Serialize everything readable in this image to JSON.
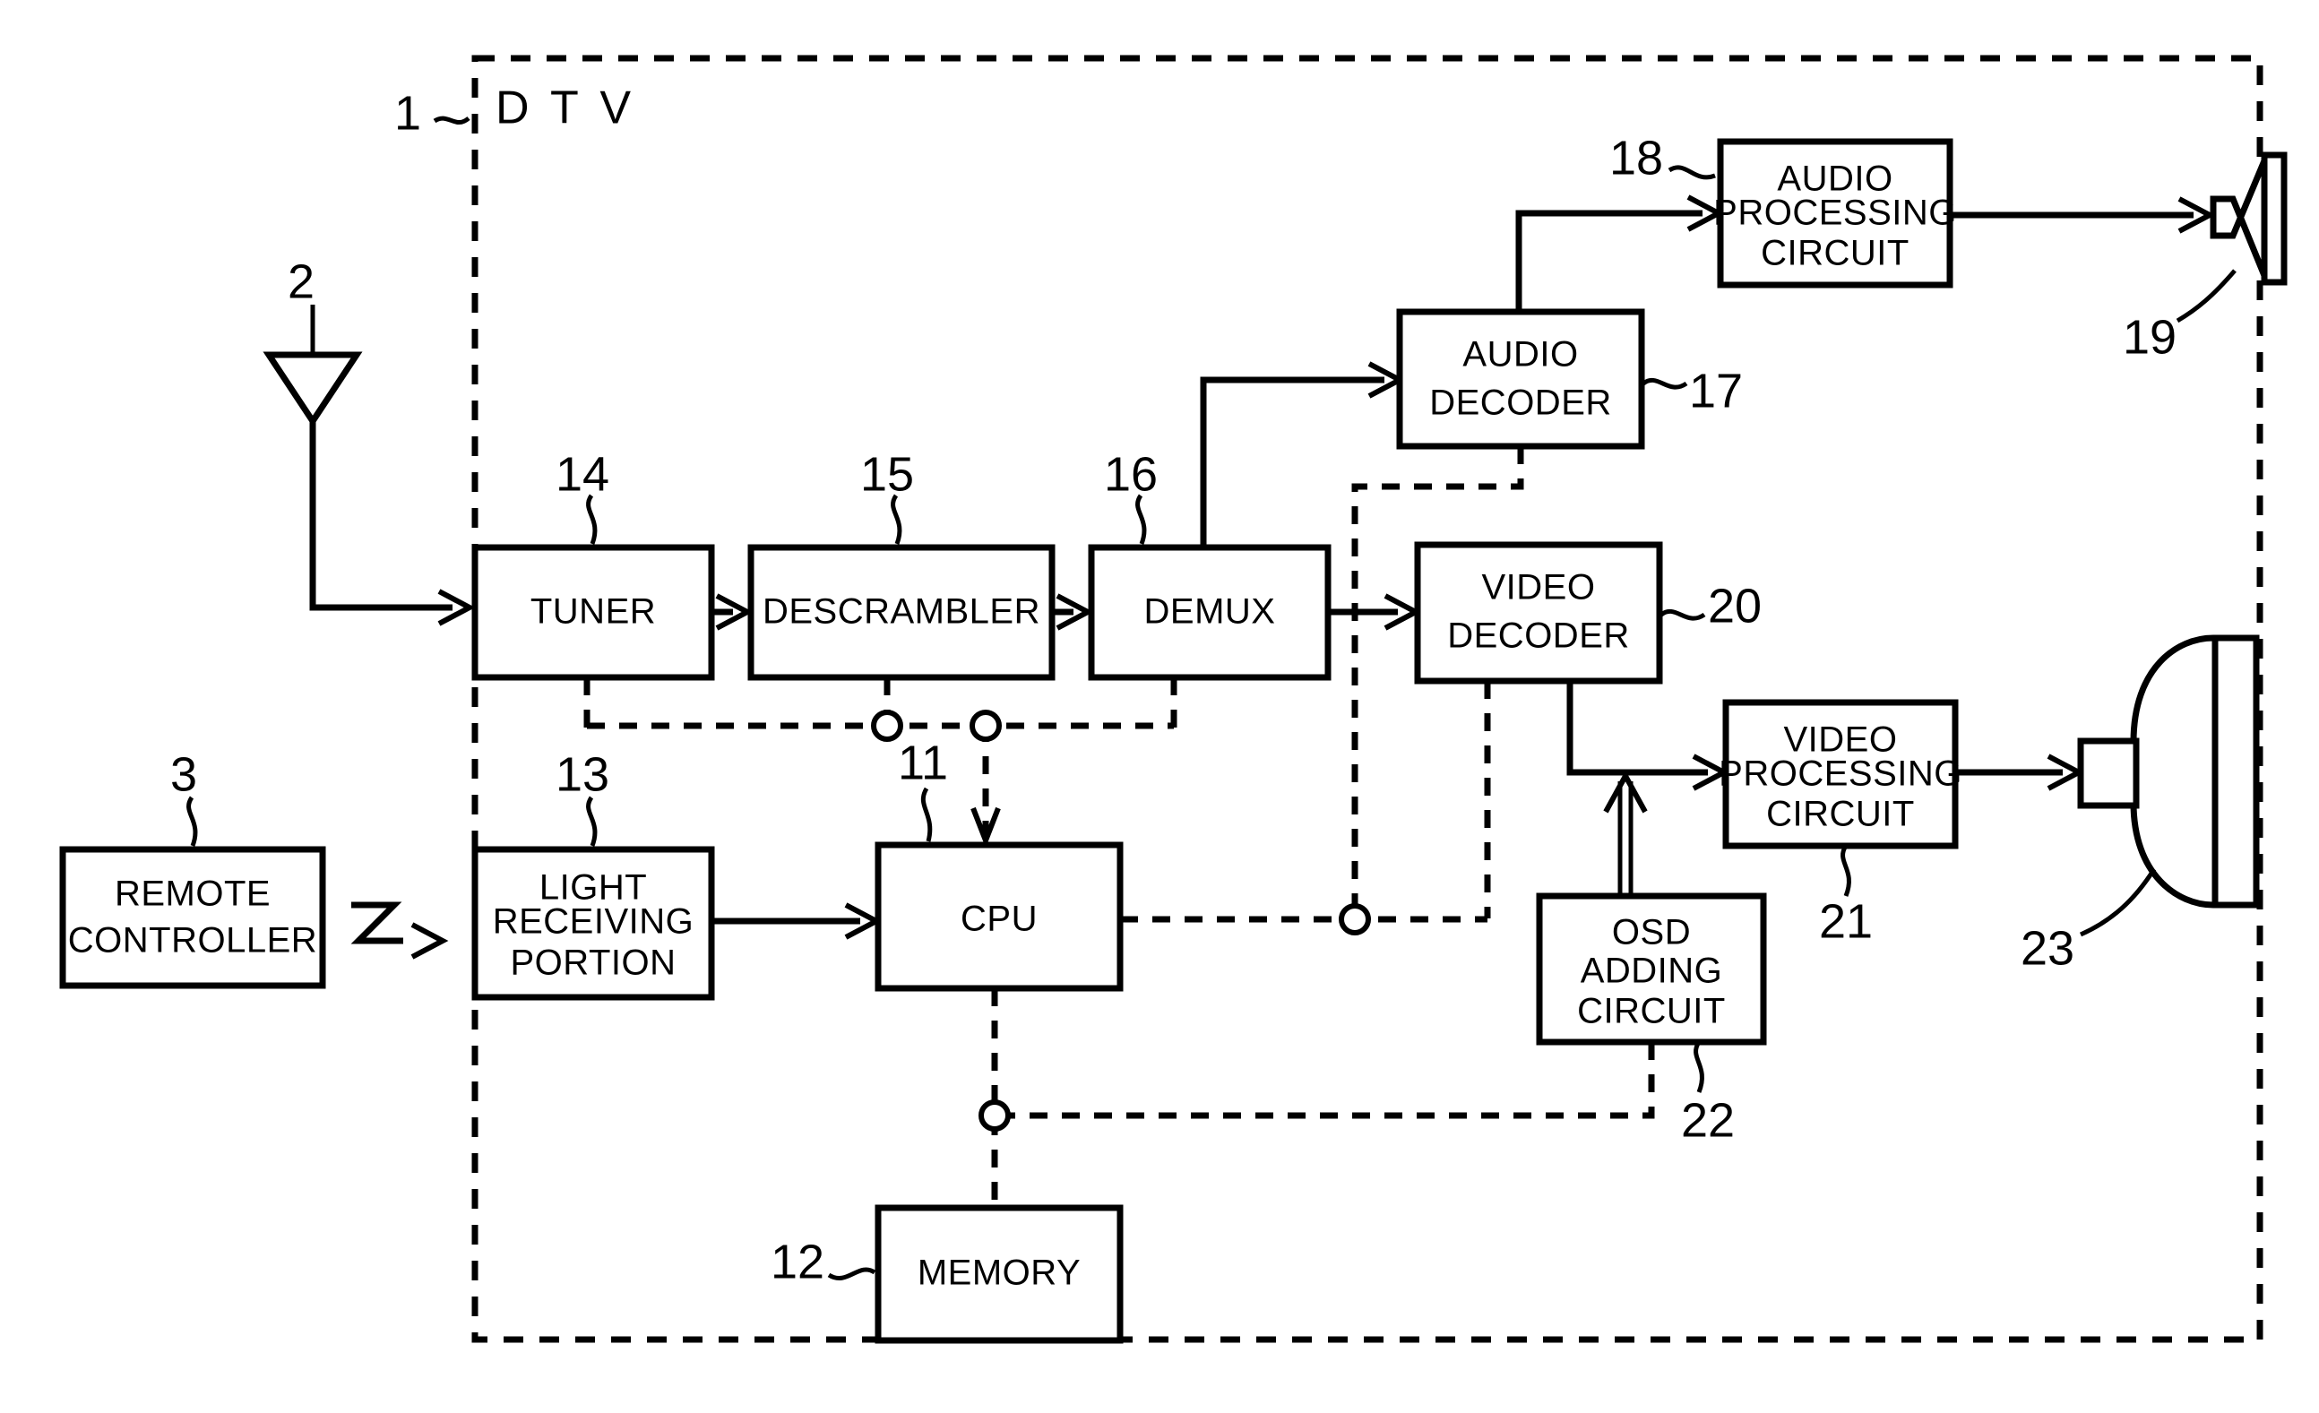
{
  "figure": {
    "title": "D T V",
    "enclosure_label_ref": "1",
    "background": "#ffffff",
    "ink": "#000000"
  },
  "external": {
    "antenna": {
      "ref": "2",
      "name": "antenna"
    },
    "remote_controller": {
      "ref": "3",
      "label_line1": "REMOTE",
      "label_line2": "CONTROLLER"
    },
    "speaker": {
      "ref": "19",
      "name": "speaker"
    },
    "crt_display": {
      "ref": "23",
      "name": "crt-display"
    }
  },
  "blocks": [
    {
      "id": "tuner",
      "ref": "14",
      "lines": [
        "TUNER"
      ]
    },
    {
      "id": "descrambler",
      "ref": "15",
      "lines": [
        "DESCRAMBLER"
      ]
    },
    {
      "id": "demux",
      "ref": "16",
      "lines": [
        "DEMUX"
      ]
    },
    {
      "id": "audio_decoder",
      "ref": "17",
      "lines": [
        "AUDIO",
        "DECODER"
      ]
    },
    {
      "id": "audio_processing",
      "ref": "18",
      "lines": [
        "AUDIO",
        "PROCESSING",
        "CIRCUIT"
      ]
    },
    {
      "id": "video_decoder",
      "ref": "20",
      "lines": [
        "VIDEO",
        "DECODER"
      ]
    },
    {
      "id": "video_processing",
      "ref": "21",
      "lines": [
        "VIDEO",
        "PROCESSING",
        "CIRCUIT"
      ]
    },
    {
      "id": "osd_adding",
      "ref": "22",
      "lines": [
        "OSD",
        "ADDING",
        "CIRCUIT"
      ]
    },
    {
      "id": "light_receiving",
      "ref": "13",
      "lines": [
        "LIGHT",
        "RECEIVING",
        "PORTION"
      ]
    },
    {
      "id": "cpu",
      "ref": "11",
      "lines": [
        "CPU"
      ]
    },
    {
      "id": "memory",
      "ref": "12",
      "lines": [
        "MEMORY"
      ]
    },
    {
      "id": "remote_controller",
      "ref": "3",
      "lines": [
        "REMOTE",
        "CONTROLLER"
      ]
    }
  ],
  "labels": {
    "tuner": "TUNER",
    "descrambler": "DESCRAMBLER",
    "demux": "DEMUX",
    "audio_decoder_l1": "AUDIO",
    "audio_decoder_l2": "DECODER",
    "audio_processing_l1": "AUDIO",
    "audio_processing_l2": "PROCESSING",
    "audio_processing_l3": "CIRCUIT",
    "video_decoder_l1": "VIDEO",
    "video_decoder_l2": "DECODER",
    "video_processing_l1": "VIDEO",
    "video_processing_l2": "PROCESSING",
    "video_processing_l3": "CIRCUIT",
    "osd_l1": "OSD",
    "osd_l2": "ADDING",
    "osd_l3": "CIRCUIT",
    "light_l1": "LIGHT",
    "light_l2": "RECEIVING",
    "light_l3": "PORTION",
    "cpu": "CPU",
    "memory": "MEMORY",
    "remote_l1": "REMOTE",
    "remote_l2": "CONTROLLER",
    "dtv_title": "D T V"
  },
  "refs": {
    "dtv": "1",
    "antenna": "2",
    "remote": "3",
    "cpu": "11",
    "memory": "12",
    "light_receiving": "13",
    "tuner": "14",
    "descrambler": "15",
    "demux": "16",
    "audio_decoder": "17",
    "audio_processing": "18",
    "speaker": "19",
    "video_decoder": "20",
    "video_processing": "21",
    "osd_adding": "22",
    "crt": "23"
  }
}
